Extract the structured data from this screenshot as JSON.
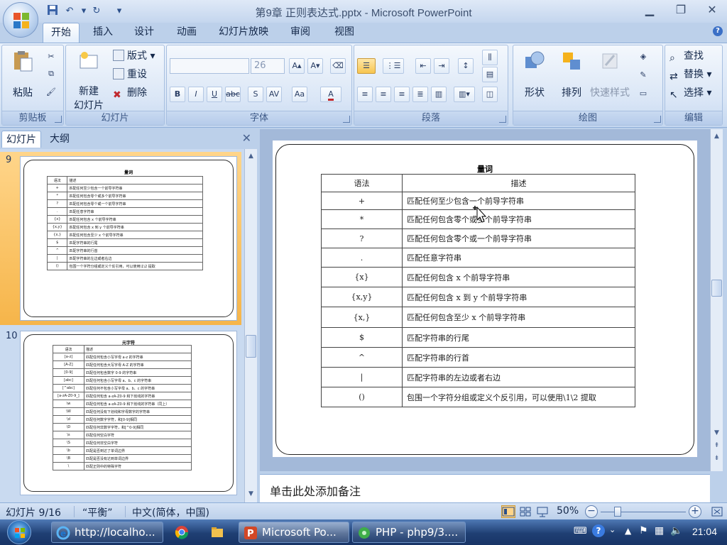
{
  "window": {
    "title": "第9章 正则表达式.pptx - Microsoft PowerPoint"
  },
  "ribbon": {
    "tabs": [
      "开始",
      "插入",
      "设计",
      "动画",
      "幻灯片放映",
      "审阅",
      "视图"
    ],
    "active_tab": "开始",
    "groups": {
      "clipboard": {
        "label": "剪贴板",
        "paste": "粘贴"
      },
      "slides": {
        "label": "幻灯片",
        "new_slide_1": "新建",
        "new_slide_2": "幻灯片",
        "layout": "版式",
        "reset": "重设",
        "delete": "删除"
      },
      "font": {
        "label": "字体",
        "size": "26"
      },
      "paragraph": {
        "label": "段落"
      },
      "drawing": {
        "label": "绘图",
        "shapes": "形状",
        "arrange": "排列",
        "quick_styles": "快速样式"
      },
      "editing": {
        "label": "编辑",
        "find": "查找",
        "replace": "替换",
        "select": "选择"
      }
    }
  },
  "left_panel": {
    "tabs": [
      "幻灯片",
      "大纲"
    ],
    "active_tab": "幻灯片",
    "slides": [
      {
        "number": "9",
        "selected": true,
        "title": "量词",
        "rows": [
          [
            "语法",
            "描述"
          ],
          [
            "+",
            "匹配任何至少包含一个前导字符串"
          ],
          [
            "*",
            "匹配任何包含零个或多个前导字符串"
          ],
          [
            "?",
            "匹配任何包含零个或一个前导字符串"
          ],
          [
            ".",
            "匹配任意字符串"
          ],
          [
            "{x}",
            "匹配任何包含 x 个前导字符串"
          ],
          [
            "{x,y}",
            "匹配任何包含 x 到 y 个前导字符串"
          ],
          [
            "{x,}",
            "匹配任何包含至少 x 个前导字符串"
          ],
          [
            "$",
            "匹配字符串的行尾"
          ],
          [
            "^",
            "匹配字符串的行首"
          ],
          [
            "|",
            "匹配字符串的左边或者右边"
          ],
          [
            "()",
            "包围一个字符分组或定义个反引用，可以使用\\1\\2 提取"
          ]
        ]
      },
      {
        "number": "10",
        "selected": false,
        "title": "元字符",
        "rows": [
          [
            "语法",
            "描述"
          ],
          [
            "[a-z]",
            "匹配任何包含小写字母 a-z 的字符串"
          ],
          [
            "[A-Z]",
            "匹配任何包含大写字母 A-Z 的字符串"
          ],
          [
            "[0-9]",
            "匹配任何包含数字 0-9 的字符串"
          ],
          [
            "[abc]",
            "匹配任何包含小写字母 a、b、c 的字符串"
          ],
          [
            "[^abc]",
            "匹配任何不包含小写字母 a、b、c 的字符串"
          ],
          [
            "[a-zA-Z0-9_]",
            "匹配任何包含 a-zA-Z0-9 和下划线的字符串"
          ],
          [
            "\\w",
            "匹配任何包含 a-zA-Z0-9 和下划线的字符串（同上）"
          ],
          [
            "\\W",
            "匹配任何没有下划线和字母数字的字符串"
          ],
          [
            "\\d",
            "匹配任何数字字符，和[0-9]相同"
          ],
          [
            "\\D",
            "匹配任何非数字字符，和[^0-9]相同"
          ],
          [
            "\\s",
            "匹配任何空白字符"
          ],
          [
            "\\S",
            "匹配任何非空白字符"
          ],
          [
            "\\b",
            "匹配是否到达了单词边界"
          ],
          [
            "\\B",
            "匹配是否没有达到单词边界"
          ],
          [
            "\\",
            "匹配正则中的特殊字符"
          ]
        ]
      }
    ]
  },
  "main_slide": {
    "title": "量词",
    "headers": [
      "语法",
      "描述"
    ],
    "rows": [
      {
        "syntax": "+",
        "desc": "匹配任何至少包含一个前导字符串"
      },
      {
        "syntax": "*",
        "desc": "匹配任何包含零个或多个前导字符串"
      },
      {
        "syntax": "?",
        "desc": "匹配任何包含零个或一个前导字符串"
      },
      {
        "syntax": ".",
        "desc": "匹配任意字符串"
      },
      {
        "syntax": "{x}",
        "desc": "匹配任何包含 x 个前导字符串"
      },
      {
        "syntax": "{x,y}",
        "desc": "匹配任何包含 x 到 y 个前导字符串"
      },
      {
        "syntax": "{x,}",
        "desc": "匹配任何包含至少 x 个前导字符串"
      },
      {
        "syntax": "$",
        "desc": "匹配字符串的行尾"
      },
      {
        "syntax": "^",
        "desc": "匹配字符串的行首"
      },
      {
        "syntax": "|",
        "desc": "匹配字符串的左边或者右边"
      },
      {
        "syntax": "()",
        "desc": "包围一个字符分组或定义个反引用，可以使用\\1\\2 提取"
      }
    ]
  },
  "notes": {
    "placeholder": "单击此处添加备注"
  },
  "status_bar": {
    "slide_info": "幻灯片 9/16",
    "theme": "“平衡”",
    "language": "中文(简体，中国)",
    "zoom": "50%",
    "zoom_fraction": 0.2
  },
  "taskbar": {
    "tasks": [
      {
        "label": "http://localho...",
        "icon": "ie-icon"
      },
      {
        "label": "Microsoft Po...",
        "icon": "powerpoint-icon",
        "active": true
      },
      {
        "label": "PHP - php9/3....",
        "icon": "php-icon"
      }
    ],
    "clock": "21:04"
  },
  "colors": {
    "ribbon_bg": "#d7e4f5",
    "selected_slide": "#f6b54a",
    "taskbar": "#1f3f73"
  }
}
